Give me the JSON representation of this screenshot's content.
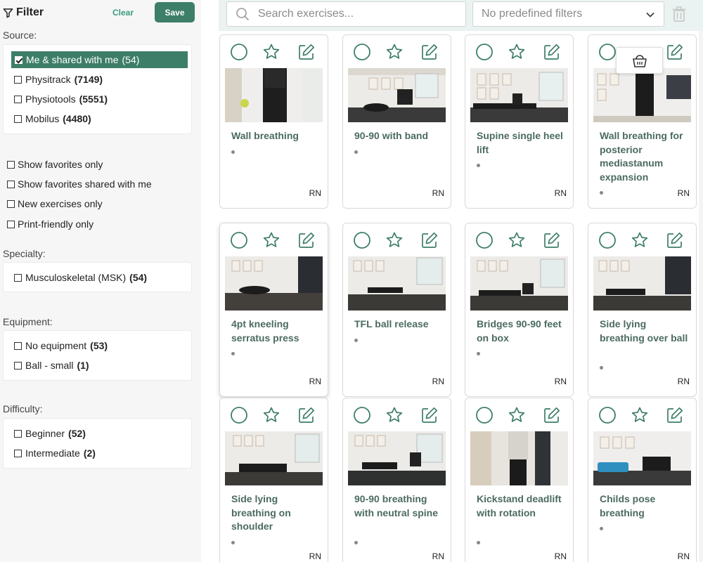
{
  "sidebar": {
    "title": "Filter",
    "clear_label": "Clear",
    "save_label": "Save",
    "source": {
      "label": "Source:",
      "items": [
        {
          "name": "Me & shared with me",
          "count": "(54)",
          "checked": true
        },
        {
          "name": "Physitrack",
          "count": "(7149)",
          "checked": false
        },
        {
          "name": "Physiotools",
          "count": "(5551)",
          "checked": false
        },
        {
          "name": "Mobilus",
          "count": "(4480)",
          "checked": false
        }
      ]
    },
    "toggles": [
      {
        "label": "Show favorites only"
      },
      {
        "label": "Show favorites shared with me"
      },
      {
        "label": "New exercises only"
      },
      {
        "label": "Print-friendly only"
      }
    ],
    "specialty": {
      "label": "Specialty:",
      "items": [
        {
          "name": "Musculoskeletal (MSK)",
          "count": "(54)"
        }
      ]
    },
    "equipment": {
      "label": "Equipment:",
      "items": [
        {
          "name": "No equipment",
          "count": "(53)"
        },
        {
          "name": "Ball - small",
          "count": "(1)"
        }
      ]
    },
    "difficulty": {
      "label": "Difficulty:",
      "items": [
        {
          "name": "Beginner",
          "count": "(52)"
        },
        {
          "name": "Intermediate",
          "count": "(2)"
        }
      ]
    }
  },
  "toolbar": {
    "search_placeholder": "Search exercises...",
    "filter_select": "No predefined filters"
  },
  "colors": {
    "accent": "#3d7e68",
    "title_text": "#4b6b5e",
    "icon": "#3d7e68"
  },
  "exercises": [
    {
      "name": "Wall breathing",
      "initials": "RN"
    },
    {
      "name": "90-90 with band",
      "initials": "RN"
    },
    {
      "name": "Supine single heel lift",
      "initials": "RN"
    },
    {
      "name": "Wall breathing for posterior mediastanum expansion",
      "initials": "RN"
    },
    {
      "name": "4pt kneeling serratus press",
      "initials": "RN"
    },
    {
      "name": "TFL ball release",
      "initials": "RN"
    },
    {
      "name": "Bridges 90-90 feet on box",
      "initials": "RN"
    },
    {
      "name": "Side lying breathing over ball",
      "initials": "RN"
    },
    {
      "name": "Side lying breathing on shoulder",
      "initials": "RN"
    },
    {
      "name": "90-90 breathing with neutral spine",
      "initials": "RN"
    },
    {
      "name": "Kickstand deadlift with rotation",
      "initials": "RN"
    },
    {
      "name": "Childs pose breathing",
      "initials": "RN"
    }
  ]
}
